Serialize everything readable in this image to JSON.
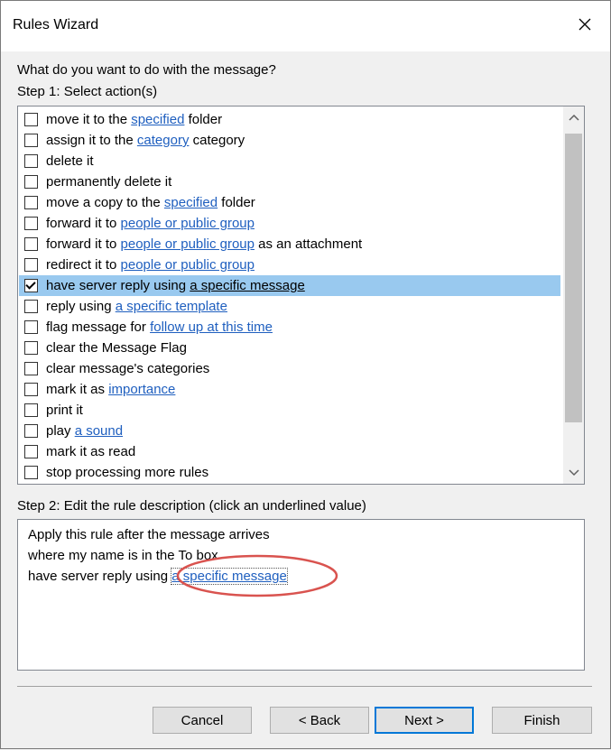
{
  "window": {
    "title": "Rules Wizard"
  },
  "prompt": "What do you want to do with the message?",
  "step1_label": "Step 1: Select action(s)",
  "actions": [
    {
      "parts": [
        {
          "t": "move it to the "
        },
        {
          "t": "specified",
          "link": true
        },
        {
          "t": " folder"
        }
      ],
      "checked": false
    },
    {
      "parts": [
        {
          "t": "assign it to the "
        },
        {
          "t": "category",
          "link": true
        },
        {
          "t": " category"
        }
      ],
      "checked": false
    },
    {
      "parts": [
        {
          "t": "delete it"
        }
      ],
      "checked": false
    },
    {
      "parts": [
        {
          "t": "permanently delete it"
        }
      ],
      "checked": false
    },
    {
      "parts": [
        {
          "t": "move a copy to the "
        },
        {
          "t": "specified",
          "link": true
        },
        {
          "t": " folder"
        }
      ],
      "checked": false
    },
    {
      "parts": [
        {
          "t": "forward it to "
        },
        {
          "t": "people or public group",
          "link": true
        }
      ],
      "checked": false
    },
    {
      "parts": [
        {
          "t": "forward it to "
        },
        {
          "t": "people or public group",
          "link": true
        },
        {
          "t": " as an attachment"
        }
      ],
      "checked": false
    },
    {
      "parts": [
        {
          "t": "redirect it to "
        },
        {
          "t": "people or public group",
          "link": true
        }
      ],
      "checked": false
    },
    {
      "parts": [
        {
          "t": "have server reply using "
        },
        {
          "t": "a specific message",
          "link": true
        }
      ],
      "checked": true,
      "selected": true
    },
    {
      "parts": [
        {
          "t": "reply using "
        },
        {
          "t": "a specific template",
          "link": true
        }
      ],
      "checked": false
    },
    {
      "parts": [
        {
          "t": "flag message for "
        },
        {
          "t": "follow up at this time",
          "link": true
        }
      ],
      "checked": false
    },
    {
      "parts": [
        {
          "t": "clear the Message Flag"
        }
      ],
      "checked": false
    },
    {
      "parts": [
        {
          "t": "clear message's categories"
        }
      ],
      "checked": false
    },
    {
      "parts": [
        {
          "t": "mark it as "
        },
        {
          "t": "importance",
          "link": true
        }
      ],
      "checked": false
    },
    {
      "parts": [
        {
          "t": "print it"
        }
      ],
      "checked": false
    },
    {
      "parts": [
        {
          "t": "play "
        },
        {
          "t": "a sound",
          "link": true
        }
      ],
      "checked": false
    },
    {
      "parts": [
        {
          "t": "mark it as read"
        }
      ],
      "checked": false
    },
    {
      "parts": [
        {
          "t": "stop processing more rules"
        }
      ],
      "checked": false
    }
  ],
  "step2_label": "Step 2: Edit the rule description (click an underlined value)",
  "description": {
    "line1": "Apply this rule after the message arrives",
    "line2": "where my name is in the To box",
    "line3_prefix": "have server reply using ",
    "line3_link": "a specific message"
  },
  "annotation_color": "#d9534f",
  "buttons": {
    "cancel": "Cancel",
    "back": "< Back",
    "next": "Next >",
    "finish": "Finish"
  },
  "icons": {
    "close": "close-icon",
    "scroll_up": "chevron-up-icon",
    "scroll_down": "chevron-down-icon"
  }
}
